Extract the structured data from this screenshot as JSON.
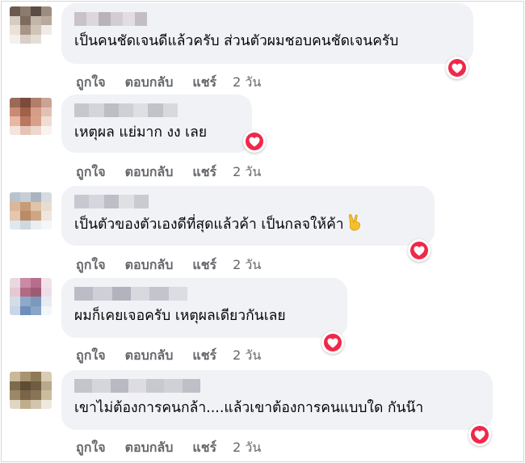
{
  "comments": [
    {
      "text": "เป็นคนชัดเจนดีแล้วครับ ส่วนตัวผมชอบคนชัดเจนครับ",
      "reaction": "heart-icon",
      "actions": {
        "like": "ถูกใจ",
        "reply": "ตอบกลับ",
        "share": "แชร์",
        "time": "2 วัน"
      },
      "avatar_colors": [
        "#6b5a4f",
        "#8c7a6d",
        "#5a4b43",
        "#9d8d80",
        "#d7ccc2",
        "#7d6b5f",
        "#c4b5aa",
        "#b8a99c",
        "#e9e1da",
        "#a89587",
        "#d0c4b8",
        "#f0ebe6",
        "#f4f0ec",
        "#d8cfc6",
        "#e6ded6",
        "#ffffff"
      ],
      "name_colors": [
        "#c9c2c8",
        "#dcd7db",
        "#b9b3b8",
        "#d3cdd2",
        "#e2dde1",
        "#c4bec3"
      ]
    },
    {
      "text": "เหตุผล แย่มาก งง เลย",
      "reaction": "heart-icon",
      "actions": {
        "like": "ถูกใจ",
        "reply": "ตอบกลับ",
        "share": "แชร์",
        "time": "2 วัน"
      },
      "avatar_colors": [
        "#9a6a57",
        "#7a4a3b",
        "#b07e6a",
        "#c9a493",
        "#c98b74",
        "#a06049",
        "#d69c85",
        "#e3c1b2",
        "#e7b7a2",
        "#b8775f",
        "#d8a08a",
        "#f0dcd2",
        "#f3e4dc",
        "#e4c4b6",
        "#efd6cb",
        "#faf2ee"
      ],
      "name_colors": [
        "#c6c6cc",
        "#d4d4da",
        "#bdbdc4",
        "#cfcfd6",
        "#dedee3",
        "#c2c2c9",
        "#d8d8dd"
      ]
    },
    {
      "text": "เป็นตัวของตัวเองดีที่สุดแล้วค้า เป็นกลจให้ค้า",
      "reaction": "heart-icon",
      "actions": {
        "like": "ถูกใจ",
        "reply": "ตอบกลับ",
        "share": "แชร์",
        "time": "2 วัน"
      },
      "avatar_colors": [
        "#b8c3cc",
        "#c7cfd6",
        "#a9b4bd",
        "#d5dbe0",
        "#d9b79a",
        "#c79b78",
        "#e0c3aa",
        "#e8dcd0",
        "#e4c7ad",
        "#b98b68",
        "#cfa684",
        "#f0e6dc",
        "#dfe8ee",
        "#cdd8e0",
        "#e8eef2",
        "#f4f7f9"
      ],
      "name_colors": [
        "#c8c8d0",
        "#d6d6dc",
        "#bebec6",
        "#e0e0e4",
        "#cacad1"
      ]
    },
    {
      "text": "ผมก็เคยเจอครับ เหตุผลเดียวกันเลย",
      "reaction": "heart-icon",
      "actions": {
        "like": "ถูกใจ",
        "reply": "ตอบกลับ",
        "share": "แชร์",
        "time": "2 วัน"
      },
      "avatar_colors": [
        "#e8d8e0",
        "#c98aa6",
        "#b76d8e",
        "#f0e4ea",
        "#e6c8d2",
        "#b06a84",
        "#9e5a74",
        "#efdde5",
        "#d3dde8",
        "#8fa8c8",
        "#7c98bd",
        "#e4ebf2",
        "#c8d6e6",
        "#6e8fbb",
        "#8aa5c9",
        "#f2f5f9"
      ],
      "name_colors": [
        "#bcbcc6",
        "#cfcfd8",
        "#b3b3be",
        "#d8d8df",
        "#c4c4cd",
        "#dcdce2"
      ]
    },
    {
      "text": "เขาไม่ต้องการคนกล้า....แล้วเขาต้องการคนแบบใด กันน๊า",
      "reaction": "heart-icon",
      "actions": {
        "like": "ถูกใจ",
        "reply": "ตอบกลับ",
        "share": "แชร์",
        "time": "2 วัน"
      },
      "avatar_colors": [
        "#c9b99a",
        "#a89470",
        "#8e7a55",
        "#d8ccb4",
        "#7e6a4c",
        "#5e4c35",
        "#6f5c41",
        "#b8a88c",
        "#9c8868",
        "#7a6548",
        "#8a7456",
        "#cabc9f",
        "#e0d6c4",
        "#bfae8e",
        "#d2c5ab",
        "#efe8dc"
      ],
      "name_colors": [
        "#c4c4cb",
        "#d5d5dc",
        "#b9b9c1",
        "#dcdce2",
        "#c8c8cf",
        "#d0d0d7",
        "#bfbfc7"
      ]
    }
  ]
}
